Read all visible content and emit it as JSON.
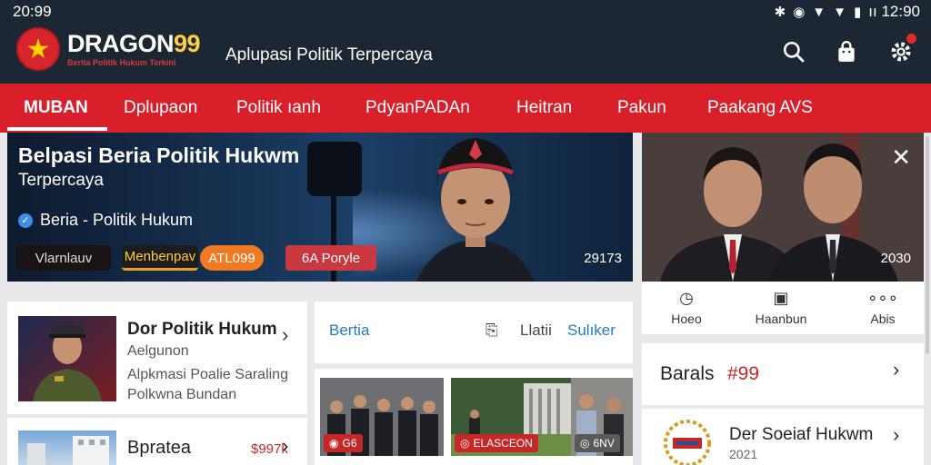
{
  "status": {
    "time": "20:99",
    "right_time": "ıı 12:90"
  },
  "header": {
    "brand_main": "DRAGON",
    "brand_num": "99",
    "brand_sub": "Berita Politik Hukum Terkini",
    "tagline": "Aplupasi Politik Terpercaya"
  },
  "nav": {
    "items": [
      "MUBAN",
      "Dplupaon",
      "Politik  ıanh",
      "PdyanPADAn",
      "Heitran",
      "Pakun",
      "Paakang   AVS"
    ]
  },
  "hero": {
    "title": "Belpasi Beria Politik Hukwm",
    "subtitle": "Terpercaya",
    "category": "Beria - Politik Hukum",
    "chips": [
      "Vlarnlauv",
      "Menbenpav",
      "ATL099",
      "6A Poryle"
    ],
    "count": "29173"
  },
  "video_panel": {
    "count": "2030",
    "actions": [
      {
        "label": "Hoeo",
        "icon": "clock-icon"
      },
      {
        "label": "Haanbun",
        "icon": "chat-icon"
      },
      {
        "label": "Abis",
        "icon": "more-icon"
      }
    ]
  },
  "list": [
    {
      "title": "Dor Politik Hukum",
      "line1": "Aelgunon",
      "line2": "Alpkmasi Poalie Saraling",
      "line3": "Polkwna Bundan"
    },
    {
      "title": "Bpratea",
      "badge": "$997k"
    }
  ],
  "tabs": {
    "items": [
      "Bertia",
      "Llatii",
      "Sulıker"
    ]
  },
  "gallery": [
    {
      "badge": "G6",
      "badge_color": "#c62828"
    },
    {
      "badge": "ELASCEON",
      "badge_color": "#c62828"
    },
    {
      "badge": "6NV",
      "badge_color": "#5a5a5a"
    }
  ],
  "right_list": [
    {
      "title": "Barals",
      "accent": "#99"
    },
    {
      "title": "Der Soeiaf Hukwm",
      "sub": "2021"
    }
  ],
  "colors": {
    "header_bg": "#1c2733",
    "nav_red": "#d9202a",
    "accent_red": "#c62828"
  }
}
